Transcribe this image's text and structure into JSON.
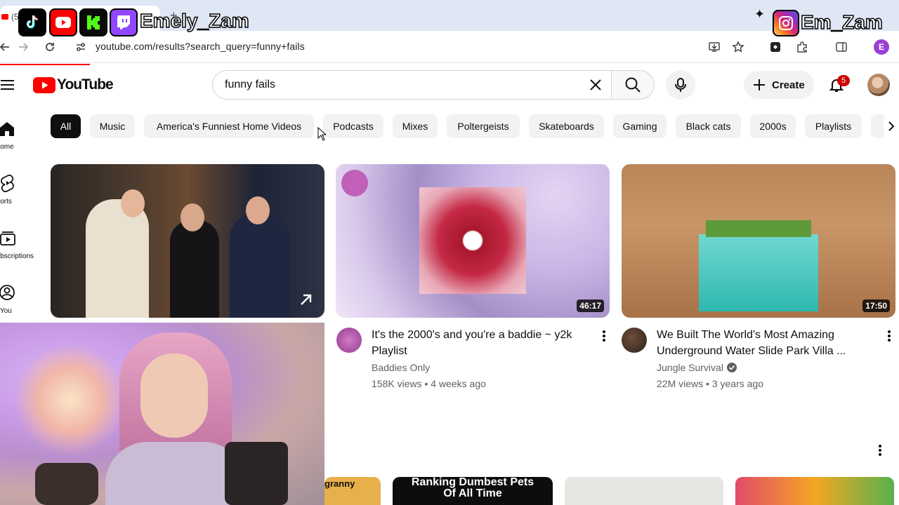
{
  "browser": {
    "url": "youtube.com/results?search_query=funny+fails",
    "profile_initial": "E",
    "tab_fragment": "(5"
  },
  "overlay": {
    "left_handle": "Emely_Zam",
    "right_handle": "Em_Zam",
    "socials": [
      "tiktok-icon",
      "youtube-icon",
      "kick-icon",
      "twitch-icon",
      "instagram-icon"
    ]
  },
  "youtube": {
    "logo_text": "YouTube",
    "search_query": "funny fails",
    "create_label": "Create",
    "notification_count": "5",
    "chips": [
      "All",
      "Music",
      "America's Funniest Home Videos",
      "Podcasts",
      "Mixes",
      "Poltergeists",
      "Skateboards",
      "Gaming",
      "Black cats",
      "2000s",
      "Playlists"
    ],
    "guide": [
      {
        "label": "Home",
        "icon": "home-icon"
      },
      {
        "label": "Shorts",
        "icon": "shorts-icon"
      },
      {
        "label": "Subscriptions",
        "icon": "subscriptions-icon"
      },
      {
        "label": "You",
        "icon": "you-icon"
      }
    ],
    "videos": [
      {
        "kind": "short-link",
        "icon": "external-arrow-icon"
      },
      {
        "duration": "46:17",
        "title": "It's the 2000's and you're a baddie ~ y2k Playlist",
        "channel": "Baddies Only",
        "views": "158K views",
        "age": "4 weeks ago",
        "verified": false
      },
      {
        "duration": "17:50",
        "title": "We Built The World's Most Amazing Underground Water Slide Park Villa ...",
        "channel": "Jungle Survival",
        "views": "22M views",
        "age": "3 years ago",
        "verified": true
      }
    ],
    "shelf": {
      "thumb_texts": [
        "granny",
        "Ranking Dumbest Pets Of All Time"
      ]
    }
  },
  "colors": {
    "brand_red": "#ff0000",
    "chip_active": "#0f0f0f",
    "chip_bg": "#f2f2f2",
    "meta_gray": "#606060",
    "notif_red": "#cc0000"
  }
}
